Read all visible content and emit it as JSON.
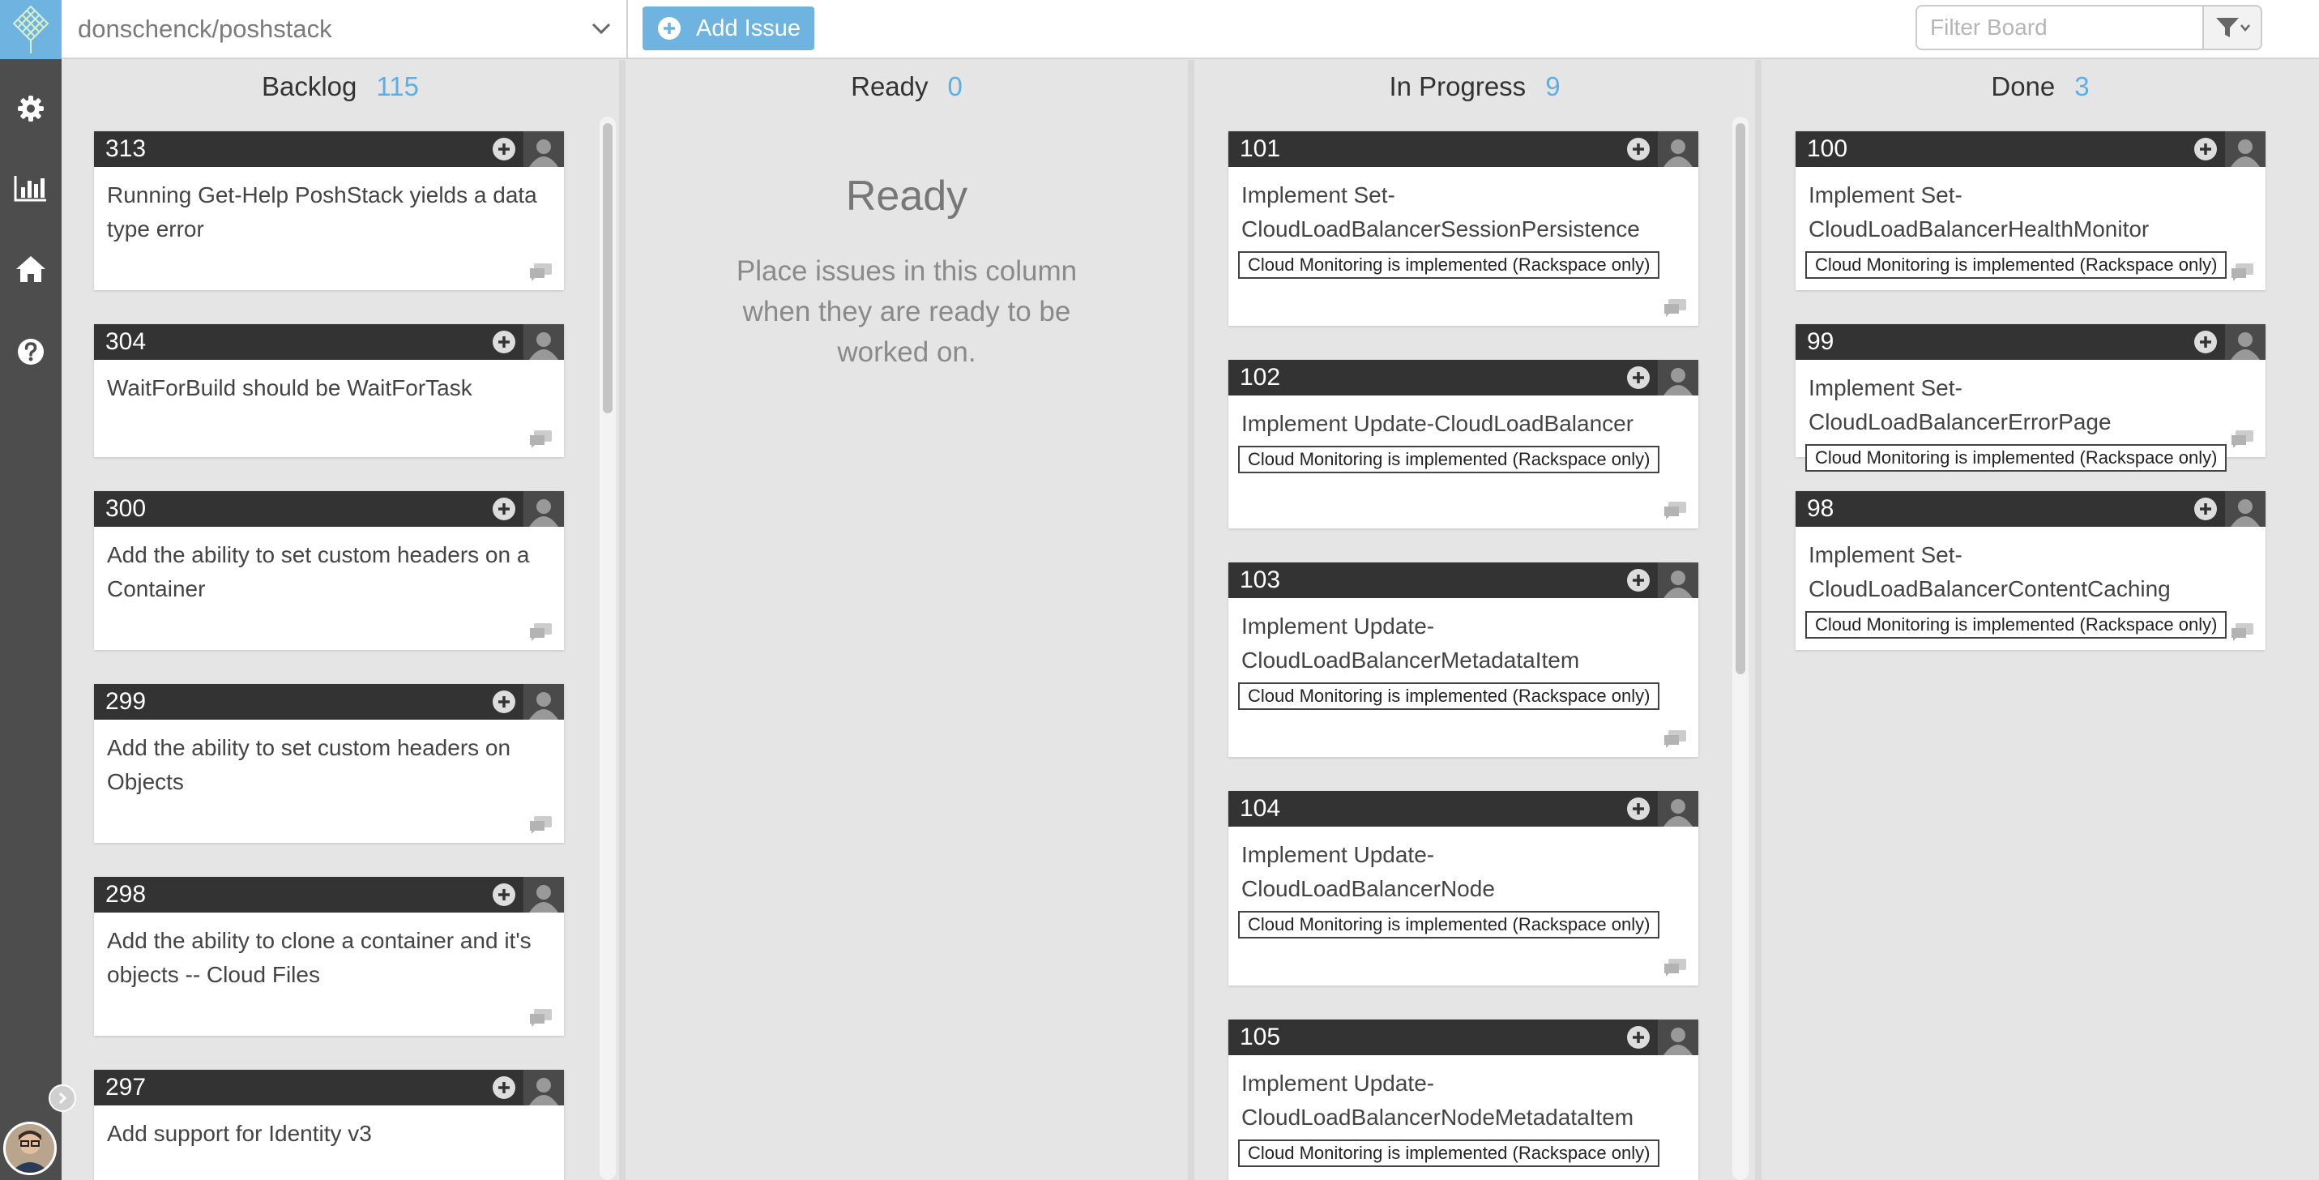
{
  "header": {
    "repo": "donschenck/poshstack",
    "add_issue_label": "Add Issue",
    "filter_placeholder": "Filter Board"
  },
  "sidebar": {
    "icons": [
      "settings-icon",
      "bar-chart-icon",
      "home-icon",
      "help-icon"
    ]
  },
  "colors": {
    "rail": "#4d4d4d",
    "accent": "#6fb4e0",
    "count": "#5ab0e6",
    "card_header": "#333333"
  },
  "milestone_text": "Cloud Monitoring is implemented (Rackspace only)",
  "columns": [
    {
      "name": "Backlog",
      "count": "115",
      "cards": [
        {
          "number": "313",
          "title": "Running Get-Help PoshStack yields a data type error"
        },
        {
          "number": "304",
          "title": "WaitForBuild should be WaitForTask"
        },
        {
          "number": "300",
          "title": "Add the ability to set custom headers on a Container"
        },
        {
          "number": "299",
          "title": "Add the ability to set custom headers on Objects"
        },
        {
          "number": "298",
          "title": "Add the ability to clone a container and it's objects -- Cloud Files"
        },
        {
          "number": "297",
          "title": "Add support for Identity v3"
        }
      ]
    },
    {
      "name": "Ready",
      "count": "0",
      "empty_title": "Ready",
      "empty_description": "Place issues in this column when they are ready to be worked on."
    },
    {
      "name": "In Progress",
      "count": "9",
      "cards": [
        {
          "number": "101",
          "title": "Implement Set-CloudLoadBalancerSessionPersistence",
          "milestone": "Cloud Monitoring is implemented (Rackspace only)"
        },
        {
          "number": "102",
          "title": "Implement Update-CloudLoadBalancer",
          "milestone": "Cloud Monitoring is implemented (Rackspace only)"
        },
        {
          "number": "103",
          "title": "Implement Update-CloudLoadBalancerMetadataItem",
          "milestone": "Cloud Monitoring is implemented (Rackspace only)"
        },
        {
          "number": "104",
          "title": "Implement Update-CloudLoadBalancerNode",
          "milestone": "Cloud Monitoring is implemented (Rackspace only)"
        },
        {
          "number": "105",
          "title": "Implement Update-CloudLoadBalancerNodeMetadataItem",
          "milestone": "Cloud Monitoring is implemented (Rackspace only)"
        }
      ]
    },
    {
      "name": "Done",
      "count": "3",
      "cards": [
        {
          "number": "100",
          "title": "Implement Set-CloudLoadBalancerHealthMonitor",
          "milestone": "Cloud Monitoring is implemented (Rackspace only)"
        },
        {
          "number": "99",
          "title": "Implement Set-CloudLoadBalancerErrorPage",
          "milestone": "Cloud Monitoring is implemented (Rackspace only)"
        },
        {
          "number": "98",
          "title": "Implement Set-CloudLoadBalancerContentCaching",
          "milestone": "Cloud Monitoring is implemented (Rackspace only)"
        }
      ]
    }
  ]
}
